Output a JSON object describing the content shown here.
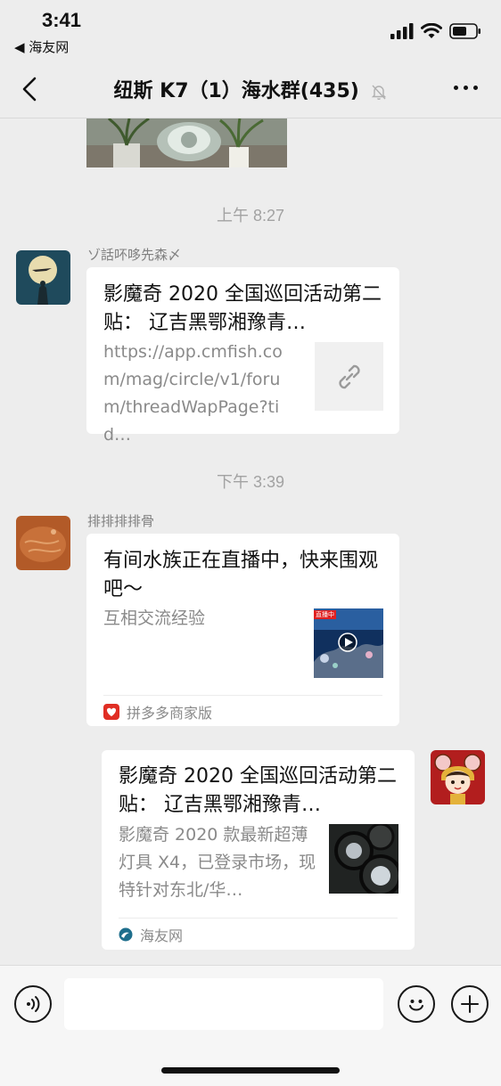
{
  "status": {
    "time": "3:41",
    "back_app": "◀ 海友网"
  },
  "header": {
    "title": "纽斯 K7（1）海水群(435)"
  },
  "messages": {
    "time1": "上午 8:27",
    "msg1": {
      "sender": "ゾ話吥哆先森〆",
      "title": "影魔奇 2020 全国巡回活动第二贴： 辽吉黑鄂湘豫青…",
      "desc": "https://app.cmfish.com/mag/circle/v1/forum/threadWapPage?tid…"
    },
    "time2": "下午 3:39",
    "msg2": {
      "sender": "排排排排骨",
      "title": "有间水族正在直播中，快来围观吧～",
      "desc": "互相交流经验",
      "thumb_badge": "直播中",
      "source": "拼多多商家版"
    },
    "msg3": {
      "title": "影魔奇 2020 全国巡回活动第二贴： 辽吉黑鄂湘豫青…",
      "desc": "影魔奇 2020 款最新超薄灯具 X4，已登录市场，现特针对东北/华…",
      "source": "海友网"
    }
  },
  "colors": {
    "background": "#ededed",
    "card": "#ffffff",
    "secondary_text": "#8a8a8a",
    "timestamp": "#a2a2a2"
  }
}
